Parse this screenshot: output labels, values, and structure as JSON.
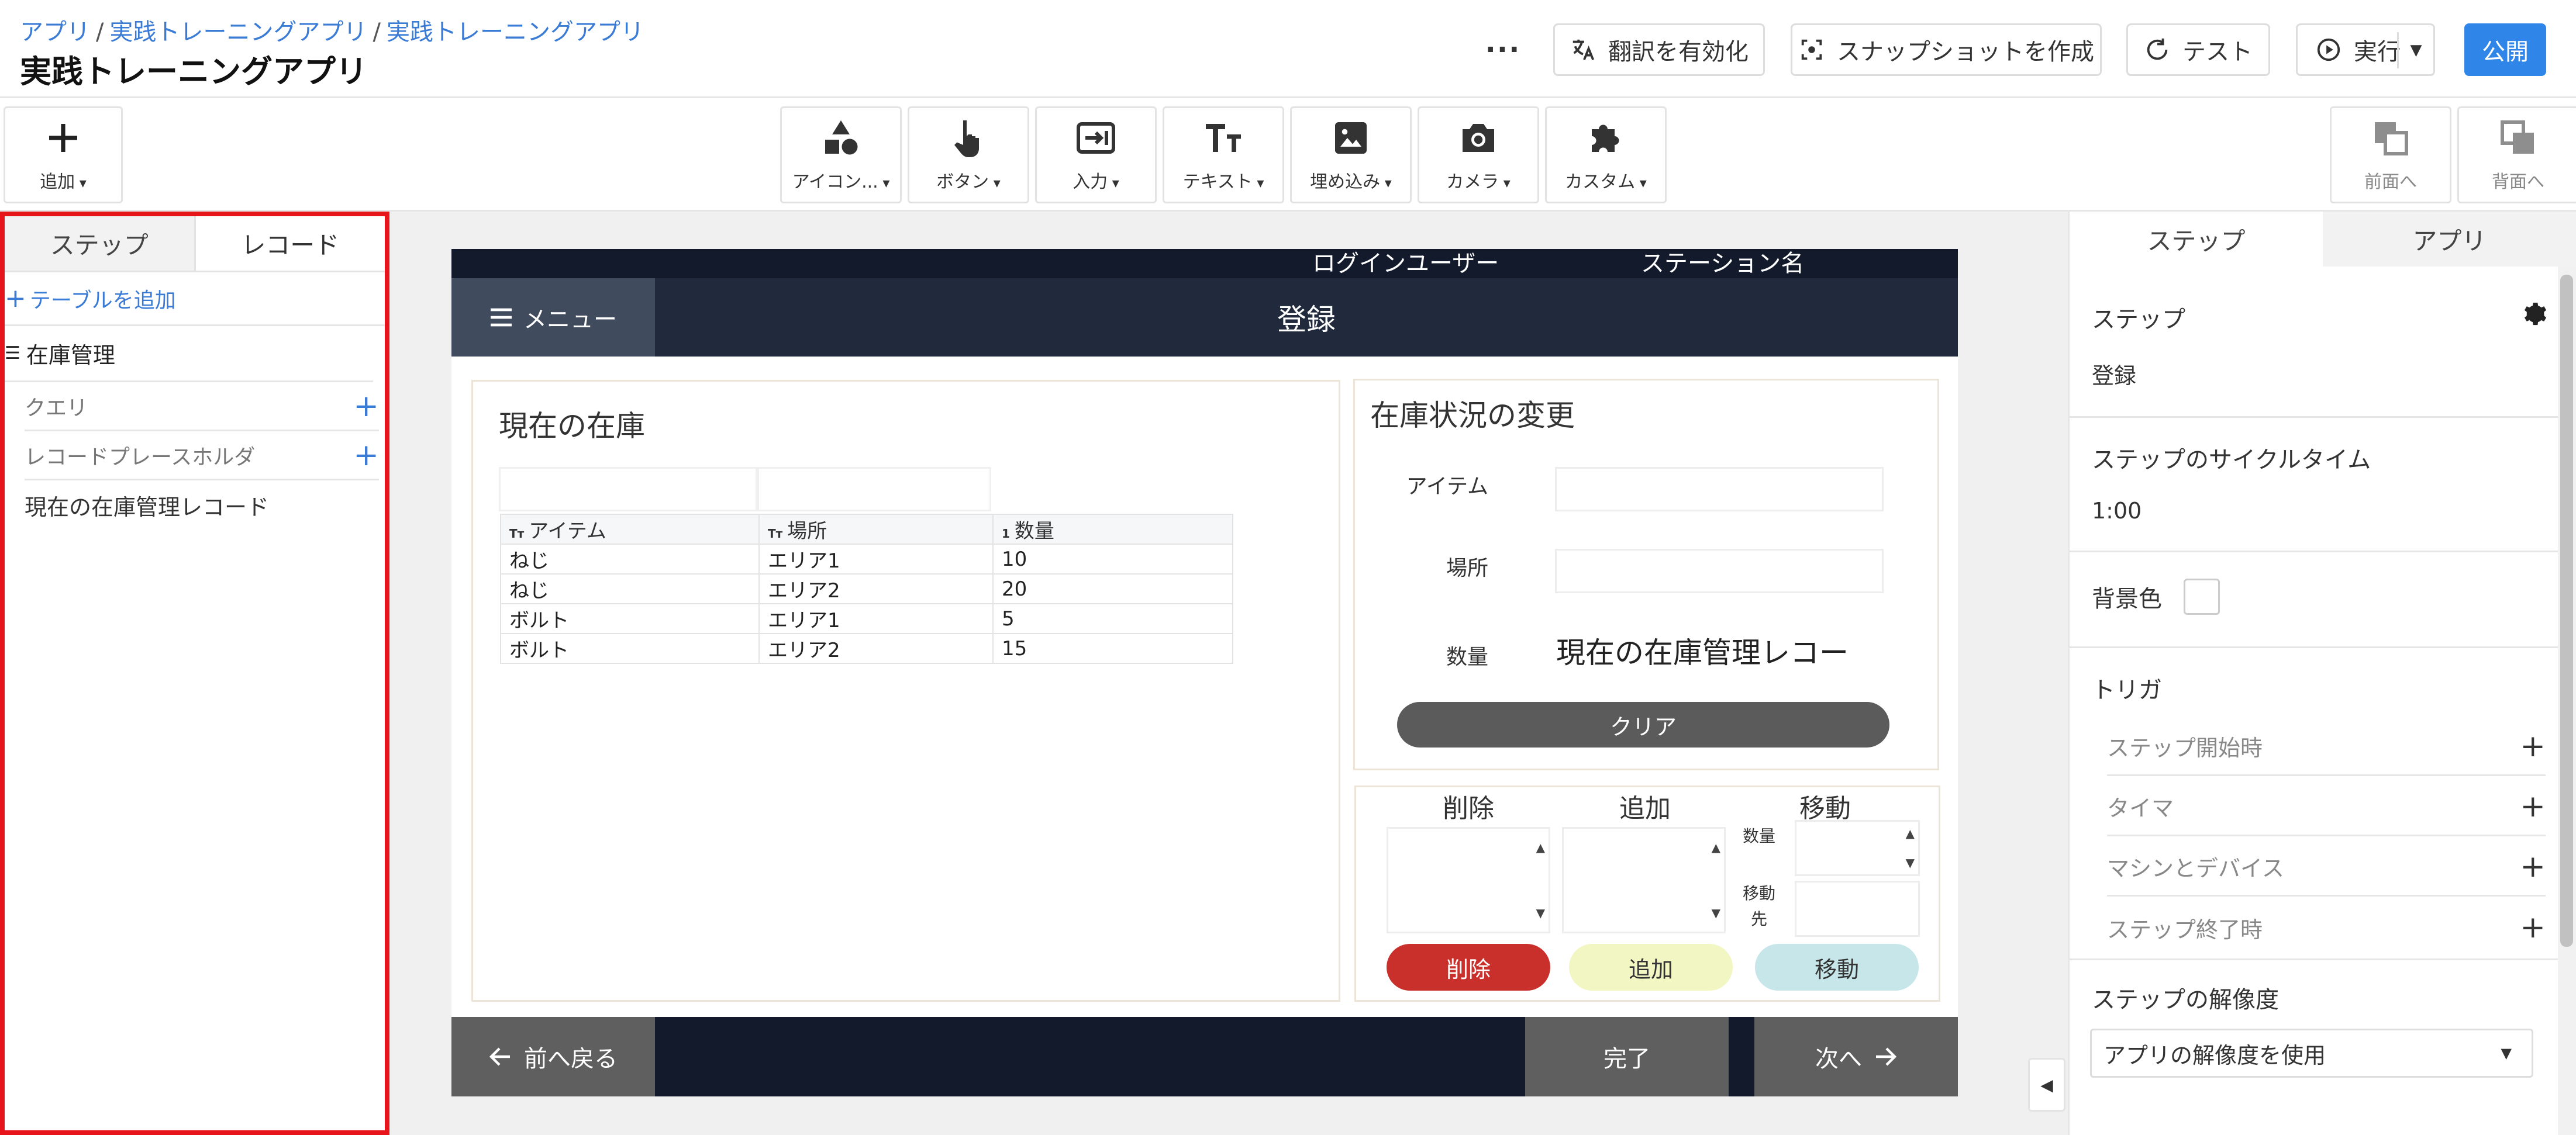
{
  "header": {
    "breadcrumb": [
      "アプリ",
      "実践トレーニングアプリ",
      "実践トレーニングアプリ"
    ],
    "breadcrumb_sep": "/",
    "title": "実践トレーニングアプリ",
    "more_label": "···",
    "translate_label": "翻訳を有効化",
    "snapshot_label": "スナップショットを作成",
    "test_label": "テスト",
    "run_label": "実行",
    "publish_label": "公開"
  },
  "toolbar": {
    "add_label": "追加",
    "tools": [
      {
        "label": "アイコン...",
        "icon": "shapes-icon"
      },
      {
        "label": "ボタン",
        "icon": "pointer-hand-icon"
      },
      {
        "label": "入力",
        "icon": "input-icon"
      },
      {
        "label": "テキスト",
        "icon": "text-icon"
      },
      {
        "label": "埋め込み",
        "icon": "image-icon"
      },
      {
        "label": "カメラ",
        "icon": "camera-icon"
      },
      {
        "label": "カスタム",
        "icon": "puzzle-icon"
      }
    ],
    "bring_front_label": "前面へ",
    "send_back_label": "背面へ"
  },
  "left_panel": {
    "tabs": [
      "ステップ",
      "レコード"
    ],
    "active_tab": "レコード",
    "add_table_label": "テーブルを追加",
    "table_name": "在庫管理",
    "query_label": "クエリ",
    "placeholder_label": "レコードプレースホルダ",
    "record_item": "現在の在庫管理レコード"
  },
  "canvas": {
    "login_user": "ログインユーザー",
    "station_name": "ステーション名",
    "menu_label": "メニュー",
    "step_title": "登録",
    "inventory": {
      "title": "現在の在庫",
      "columns": [
        {
          "type": "Tт",
          "label": "アイテム"
        },
        {
          "type": "Tт",
          "label": "場所"
        },
        {
          "type": "1",
          "label": "数量"
        }
      ],
      "rows": [
        [
          "ねじ",
          "エリア1",
          "10"
        ],
        [
          "ねじ",
          "エリア2",
          "20"
        ],
        [
          "ボルト",
          "エリア1",
          "5"
        ],
        [
          "ボルト",
          "エリア2",
          "15"
        ]
      ]
    },
    "change": {
      "title": "在庫状況の変更",
      "item_label": "アイテム",
      "location_label": "場所",
      "quantity_label": "数量",
      "quantity_value": "現在の在庫管理レコー",
      "clear_label": "クリア"
    },
    "actions": {
      "delete_title": "削除",
      "add_title": "追加",
      "move_title": "移動",
      "qty_label": "数量",
      "dest_label_1": "移動",
      "dest_label_2": "先",
      "delete_button": "削除",
      "add_button": "追加",
      "move_button": "移動",
      "colors": {
        "delete": "#c9302c",
        "add": "#f2f6c2",
        "move": "#c6e6ea"
      }
    },
    "footer": {
      "back_label": "前へ戻る",
      "done_label": "完了",
      "next_label": "次へ"
    }
  },
  "right_panel": {
    "tabs": [
      "ステップ",
      "アプリ"
    ],
    "active_tab": "ステップ",
    "step_label": "ステップ",
    "step_value": "登録",
    "cycle_label": "ステップのサイクルタイム",
    "cycle_value": "1:00",
    "bg_label": "背景色",
    "trigger_label": "トリガ",
    "triggers": [
      "ステップ開始時",
      "タイマ",
      "マシンとデバイス",
      "ステップ終了時"
    ],
    "resolution_label": "ステップの解像度",
    "resolution_value": "アプリの解像度を使用"
  }
}
